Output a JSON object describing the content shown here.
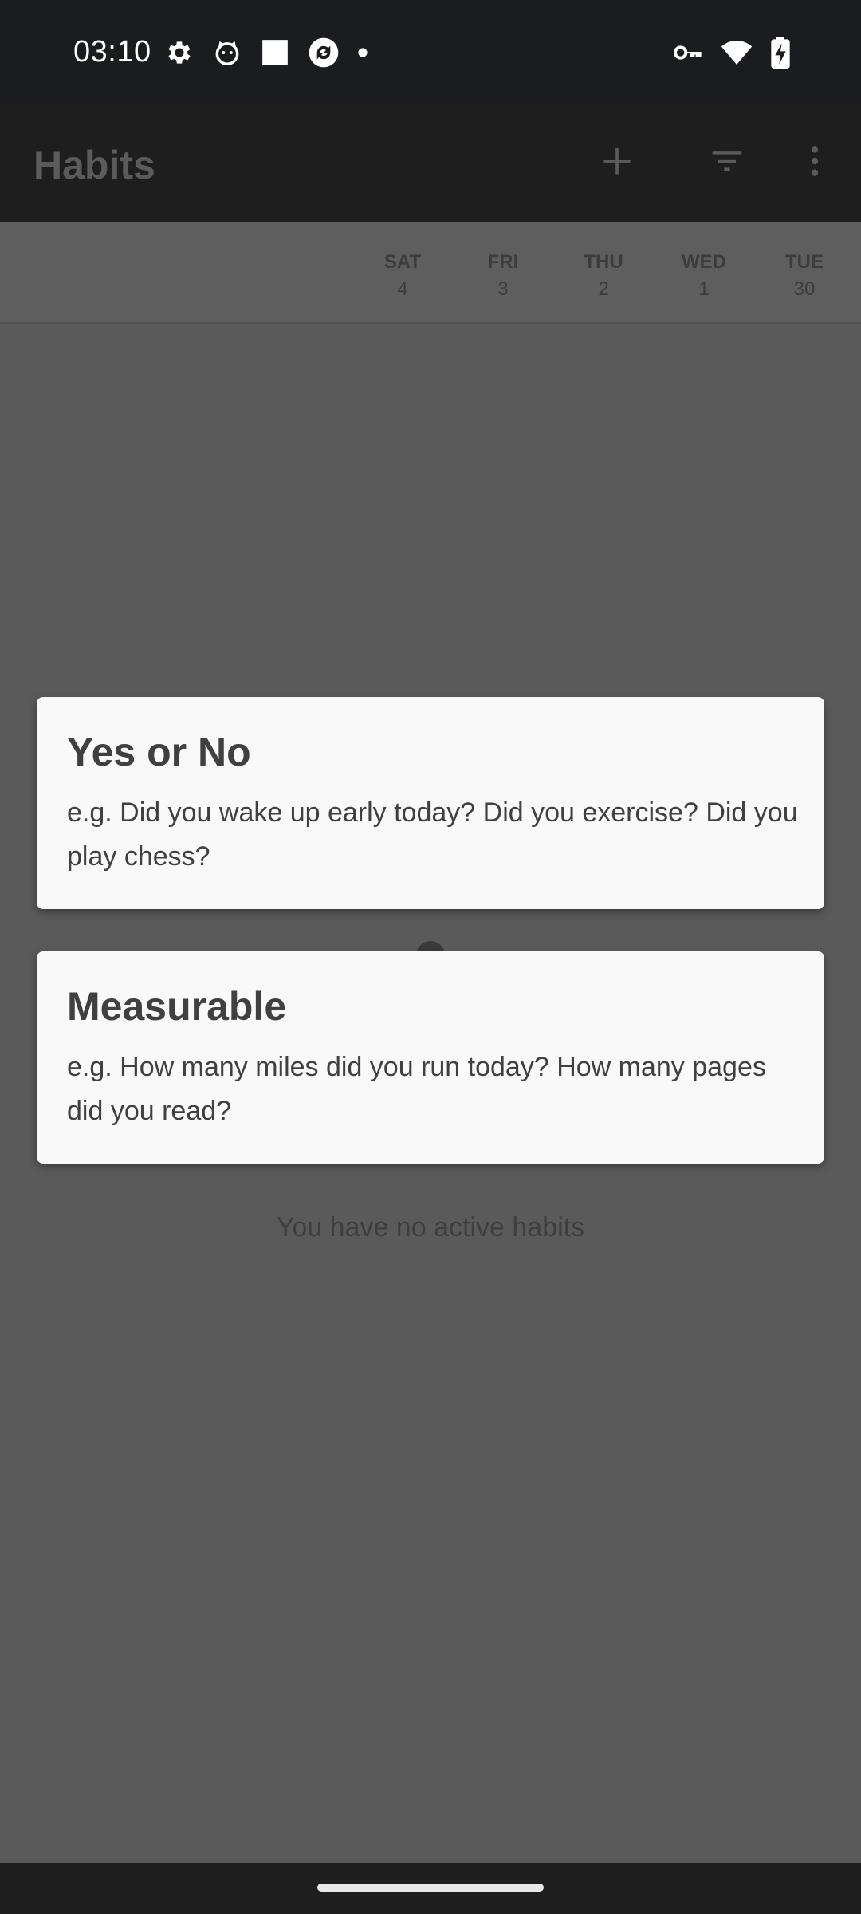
{
  "status_bar": {
    "time": "03:10",
    "left_icons": [
      "settings-icon",
      "cat-icon",
      "square-icon",
      "sync-app-icon",
      "dot-icon"
    ],
    "right_icons": [
      "key-icon",
      "wifi-icon",
      "battery-charging-icon"
    ]
  },
  "toolbar": {
    "title": "Habits",
    "actions": [
      "add-icon",
      "filter-icon",
      "more-vert-icon"
    ]
  },
  "days": [
    {
      "name": "SAT",
      "num": "4"
    },
    {
      "name": "FRI",
      "num": "3"
    },
    {
      "name": "THU",
      "num": "2"
    },
    {
      "name": "WED",
      "num": "1"
    },
    {
      "name": "TUE",
      "num": "30"
    }
  ],
  "empty_state": "You have no active habits",
  "dialog": {
    "options": [
      {
        "title": "Yes or No",
        "description": "e.g. Did you wake up early today? Did you exercise? Did you play chess?"
      },
      {
        "title": "Measurable",
        "description": "e.g. How many miles did you run today? How many pages did you read?"
      }
    ]
  },
  "colors": {
    "status_bar": "#1b1c20",
    "toolbar": "#1e1e1e",
    "scrim_background": "#5a5a5a",
    "card": "#f9f9f9"
  }
}
